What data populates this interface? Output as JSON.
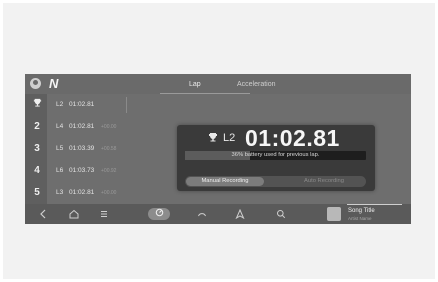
{
  "header": {
    "brand_logo": "N",
    "tabs": [
      {
        "label": "Lap",
        "active": true
      },
      {
        "label": "Acceleration",
        "active": false
      }
    ]
  },
  "rankings": [
    {
      "rank": "",
      "icon": "trophy-icon",
      "lap": "L2",
      "time": "01:02.81",
      "extra": ""
    },
    {
      "rank": "2",
      "lap": "L4",
      "time": "01:02.81",
      "extra": "+00.00"
    },
    {
      "rank": "3",
      "lap": "L5",
      "time": "01:03.39",
      "extra": "+00.58"
    },
    {
      "rank": "4",
      "lap": "L6",
      "time": "01:03.73",
      "extra": "+00.92"
    },
    {
      "rank": "5",
      "lap": "L3",
      "time": "01:02.81",
      "extra": "+00.00"
    }
  ],
  "popup": {
    "lap": "L2",
    "time": "01:02.81",
    "battery_text": "36% battery used for previous lap.",
    "battery_used_fraction": 0.36,
    "segment_active": "Manual Recording",
    "segment_inactive": "Auto Recording"
  },
  "bottom_bar": {
    "icons": [
      "back-icon",
      "home-icon",
      "menu-icon",
      "drive-mode-icon",
      "gauge-icon",
      "navigation-icon",
      "search-icon"
    ],
    "song_title": "Song Title",
    "artist_name": "Artist Name"
  }
}
